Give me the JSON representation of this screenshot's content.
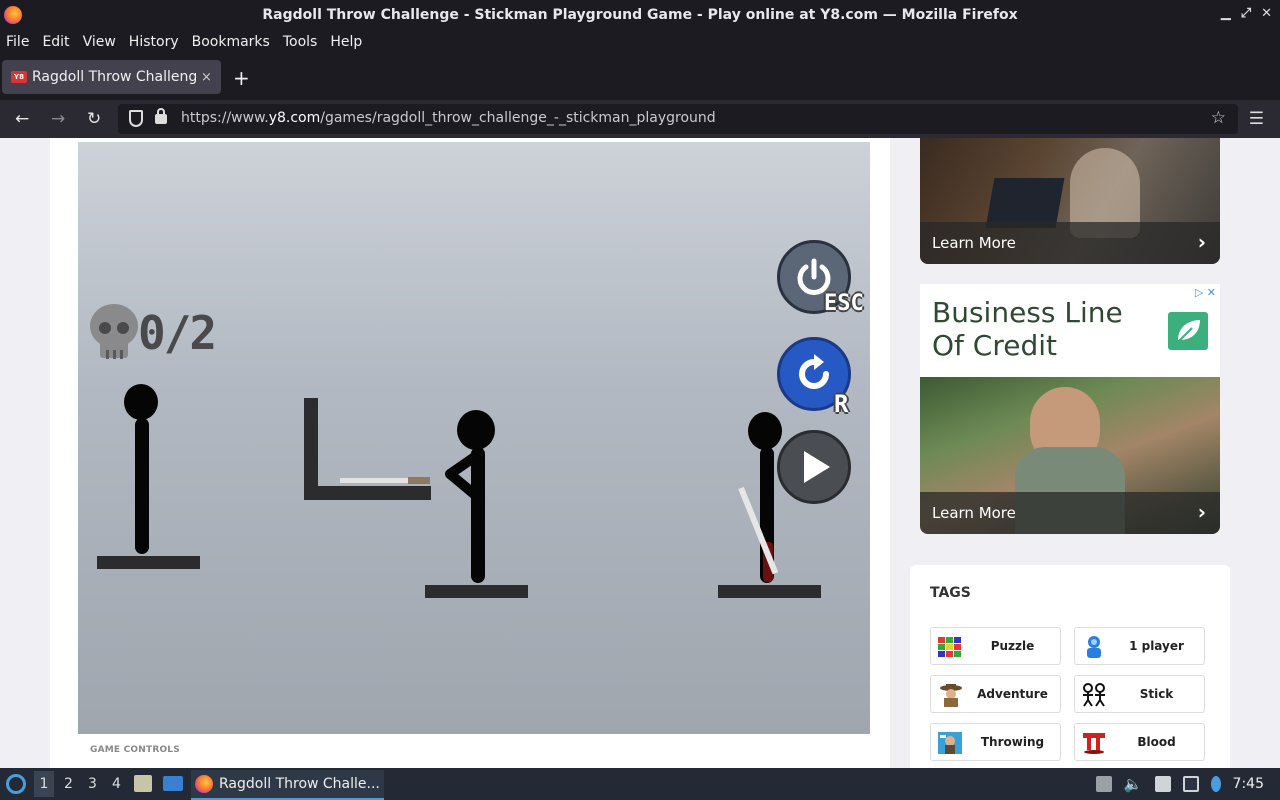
{
  "window": {
    "title": "Ragdoll Throw Challenge - Stickman Playground Game - Play online at Y8.com — Mozilla Firefox"
  },
  "menu": [
    "File",
    "Edit",
    "View",
    "History",
    "Bookmarks",
    "Tools",
    "Help"
  ],
  "tab": {
    "favicon": "Y8",
    "label": "Ragdoll Throw Challenge - Stickman Playground",
    "close": "×",
    "new": "+"
  },
  "nav": {
    "url_prefix": "https://www.",
    "url_domain": "y8.com",
    "url_path": "/games/ragdoll_throw_challenge_-_stickman_playground"
  },
  "game": {
    "kill_counter": "0/2",
    "esc_label": "ESC",
    "restart_label": "R",
    "controls_heading": "GAME CONTROLS"
  },
  "ads": {
    "ad1": {
      "cta": "Learn More"
    },
    "ad2": {
      "headline_line1": "Business Line",
      "headline_line2": "Of Credit",
      "cta": "Learn More",
      "adchoices": "▷ ✕"
    }
  },
  "tags": {
    "title": "TAGS",
    "items": [
      {
        "label": "Puzzle",
        "icon": "puzzle-grid-icon"
      },
      {
        "label": "1 player",
        "icon": "player-icon"
      },
      {
        "label": "Adventure",
        "icon": "adventurer-icon"
      },
      {
        "label": "Stick",
        "icon": "stickmen-icon"
      },
      {
        "label": "Throwing",
        "icon": "throwing-icon"
      },
      {
        "label": "Blood",
        "icon": "blood-icon"
      }
    ]
  },
  "taskbar": {
    "workspaces": [
      "1",
      "2",
      "3",
      "4"
    ],
    "app_label": "Ragdoll Throw Challe...",
    "clock": "7:45"
  }
}
